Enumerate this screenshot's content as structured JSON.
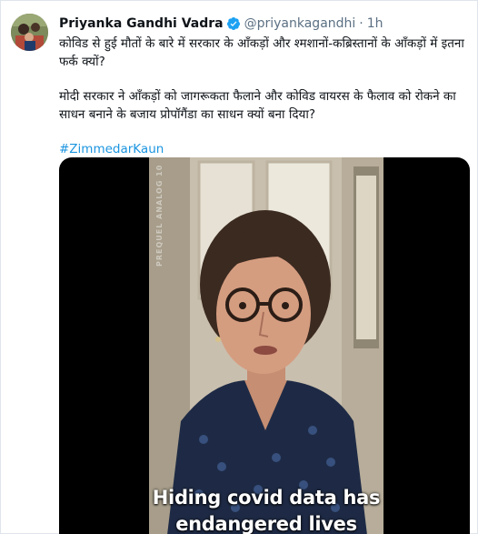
{
  "user": {
    "name": "Priyanka Gandhi Vadra",
    "handle": "@priyankagandhi",
    "separator": "·",
    "time": "1h",
    "avatar_icon": "profile-photo",
    "verified_icon": "verified-badge-icon",
    "verified_color": "#1da1f2"
  },
  "tweet": {
    "paragraph1": "कोविड से हुई मौतों के बारे में सरकार के आँकड़ों और श्मशानों-कब्रिस्तानों के आँकड़ों में इतना फर्क क्यों?",
    "paragraph2": "मोदी सरकार ने आँकड़ों को जागरूकता फैलाने और कोविड वायरस के फैलाव को रोकने का साधन बनाने के बजाय प्रोपॉगैंडा का साधन क्यों बना दिया?",
    "hashtag": "#ZimmedarKaun",
    "hashtag_color": "#1b95e0"
  },
  "media": {
    "caption_line1": "Hiding covid data has",
    "caption_line2": "endangered lives",
    "side_tag": "PREQUEL ANALOG  10"
  }
}
